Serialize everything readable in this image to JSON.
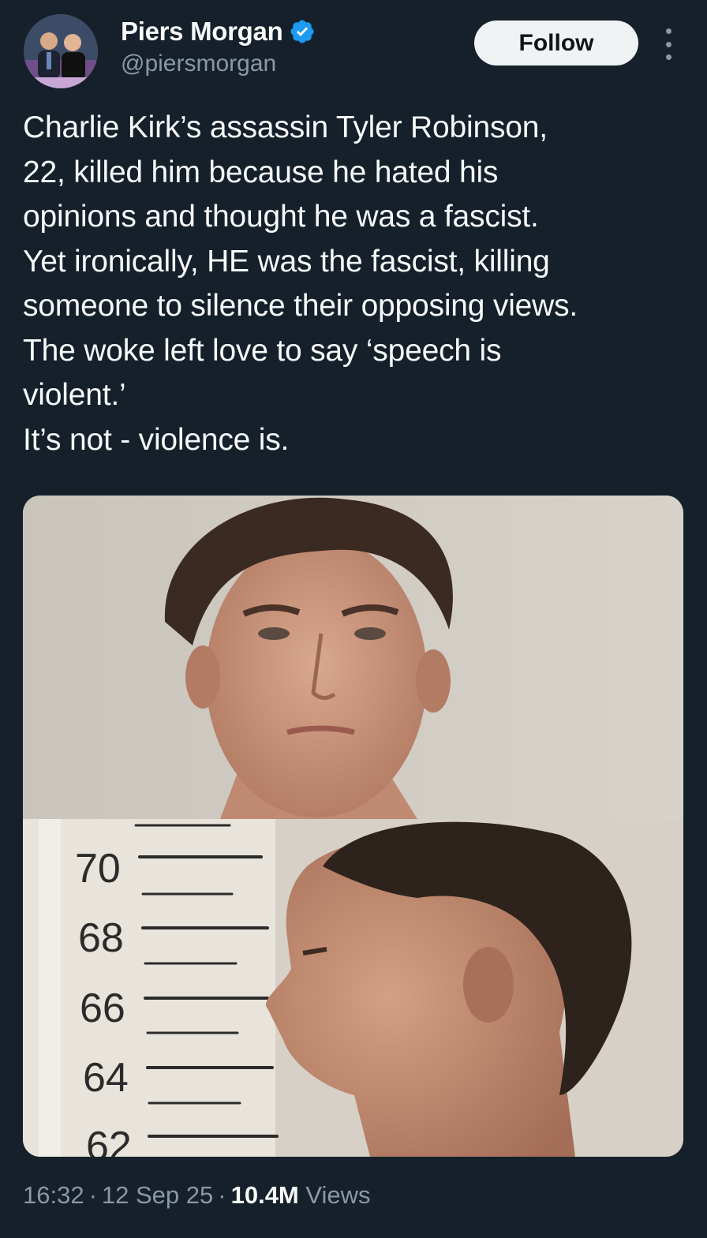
{
  "author": {
    "display_name": "Piers Morgan",
    "handle": "@piersmorgan",
    "verified": true,
    "verified_color": "#1d9bf0"
  },
  "actions": {
    "follow_label": "Follow"
  },
  "tweet": {
    "lines": [
      "Charlie Kirk’s assassin Tyler Robinson,",
      "22, killed him because he hated his",
      "opinions and thought he was a fascist.",
      "Yet ironically, HE was the fascist, killing",
      "someone to silence their opposing views.",
      "The woke left love to say ‘speech is",
      "violent.’",
      "It’s not - violence is."
    ]
  },
  "media": {
    "height_chart_labels": [
      "70",
      "68",
      "66",
      "64",
      "62"
    ]
  },
  "meta": {
    "time": "16:32",
    "date": "12 Sep 25",
    "views_count": "10.4M",
    "views_label": "Views"
  },
  "colors": {
    "background": "#15202b",
    "text_primary": "#f7f9f9",
    "text_secondary": "#8b98a5",
    "button_bg": "#eff3f4"
  }
}
